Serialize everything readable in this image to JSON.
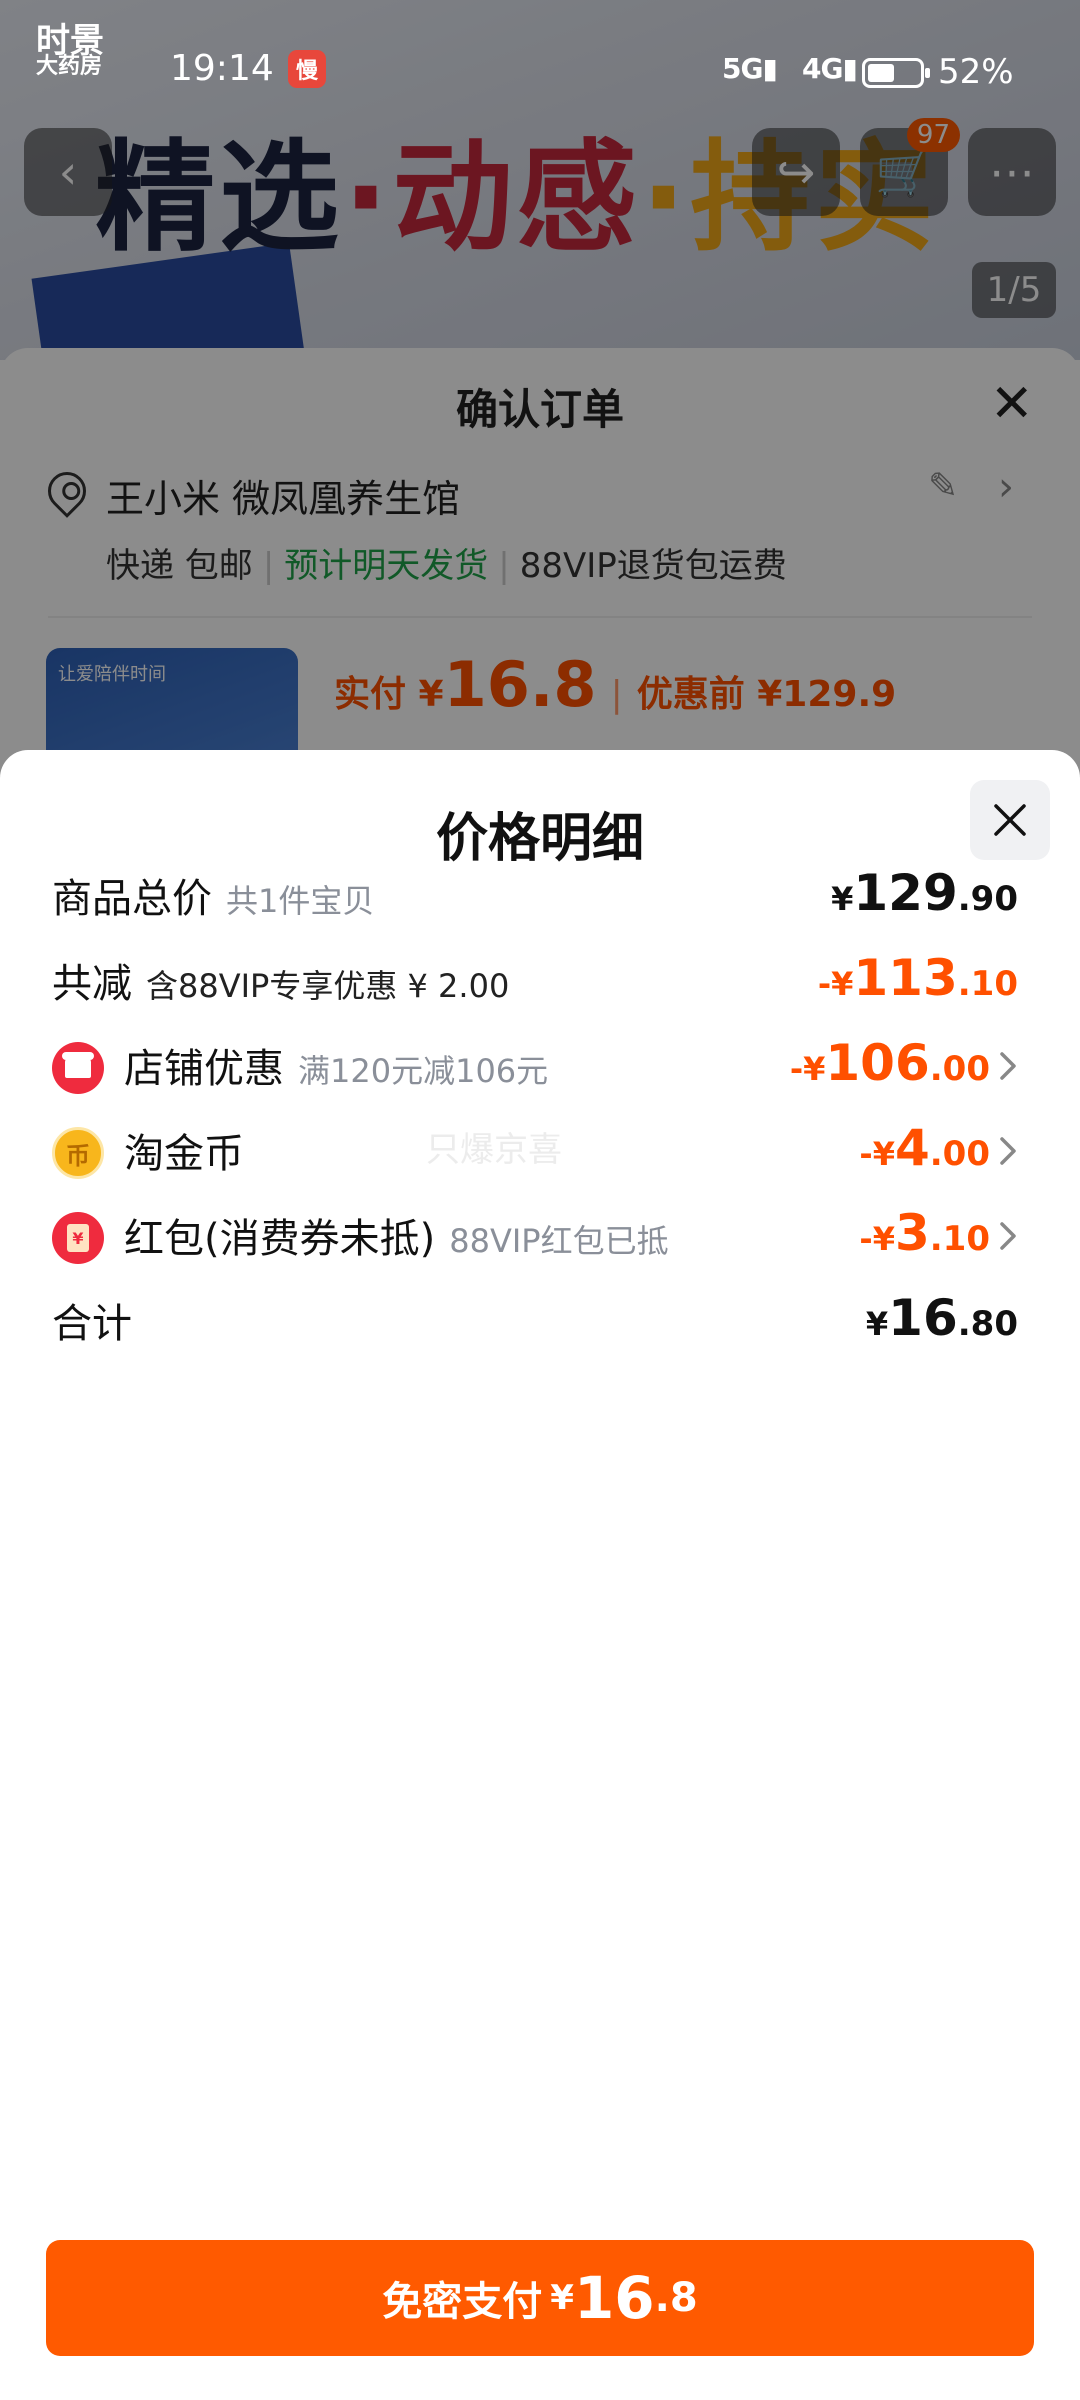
{
  "status_bar": {
    "logo_line1": "时景",
    "logo_line2": "大药房",
    "time": "19:14",
    "app_icon_glyph": "慢",
    "signal1": "5G",
    "signal2": "4G",
    "battery_level": 0.52,
    "battery_percent": "52%"
  },
  "background_page": {
    "banner_word1": "精选",
    "banner_dot1": "·",
    "banner_word2": "动感",
    "banner_dot2": "·",
    "banner_word3": "持实",
    "cart_badge": "97",
    "image_indicator": "1/5"
  },
  "order_sheet": {
    "title": "确认订单",
    "address_name": "王小米 微凤凰养生馆",
    "shipping_method": "快递 包邮",
    "shipping_eta": "预计明天发货",
    "return_shipping": "88VIP退货包运费",
    "thumb_caption": "让爱陪伴时间",
    "paid_label": "实付 ¥",
    "paid_amount": "16.8",
    "before_discount": "优惠前 ¥129.9"
  },
  "price_detail": {
    "title": "价格明细",
    "watermark": "只爆京喜",
    "rows": [
      {
        "label": "商品总价",
        "note": "共1件宝贝",
        "currency": "¥",
        "integer": "129",
        "decimal": ".90",
        "has_chevron": false
      },
      {
        "label": "共减",
        "note": "含88VIP专享优惠 ¥ 2.00",
        "currency": "-¥",
        "integer": "113",
        "decimal": ".10",
        "has_chevron": false
      },
      {
        "label": "店铺优惠",
        "note": "满120元减106元",
        "currency": "-¥",
        "integer": "106",
        "decimal": ".00",
        "has_chevron": true,
        "icon": "store-icon"
      },
      {
        "label": "淘金币",
        "note": "",
        "currency": "-¥",
        "integer": "4",
        "decimal": ".00",
        "has_chevron": true,
        "icon": "gold-coin-icon",
        "icon_glyph": "币"
      },
      {
        "label": "红包(消费券未抵)",
        "note": "88VIP红包已抵",
        "currency": "-¥",
        "integer": "3",
        "decimal": ".10",
        "has_chevron": true,
        "icon": "red-packet-icon",
        "icon_glyph": "¥"
      },
      {
        "label": "合计",
        "note": "",
        "currency": "¥",
        "integer": "16",
        "decimal": ".80",
        "has_chevron": false
      }
    ],
    "pay_button": {
      "label": "免密支付",
      "currency": "¥",
      "integer": "16",
      "decimal": ".8"
    }
  },
  "colors": {
    "accent_orange": "#ff5a00",
    "discount_orange": "#ff5000",
    "eta_green": "#1fa34a",
    "store_red": "#ef2b3e",
    "coin_gold": "#f8b61c"
  }
}
